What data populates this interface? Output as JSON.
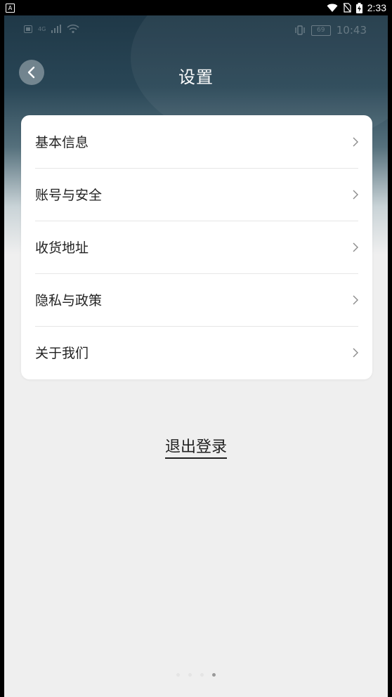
{
  "system_status": {
    "left_icon": "A",
    "time": "2:33",
    "icons": [
      "wifi-icon",
      "sim-off-icon",
      "battery-charging-icon"
    ]
  },
  "inner_status": {
    "time": "10:43",
    "battery": "69",
    "signal": "4G"
  },
  "header": {
    "title": "设置",
    "back_icon": "chevron-left-icon"
  },
  "settings": {
    "items": [
      {
        "label": "基本信息"
      },
      {
        "label": "账号与安全"
      },
      {
        "label": "收货地址"
      },
      {
        "label": "隐私与政策"
      },
      {
        "label": "关于我们"
      }
    ]
  },
  "logout": {
    "label": "退出登录"
  },
  "pager": {
    "count": 4,
    "active_index": 3
  },
  "colors": {
    "header_dark": "#1f3847",
    "background": "#efefef",
    "card": "#ffffff",
    "text": "#222222"
  }
}
